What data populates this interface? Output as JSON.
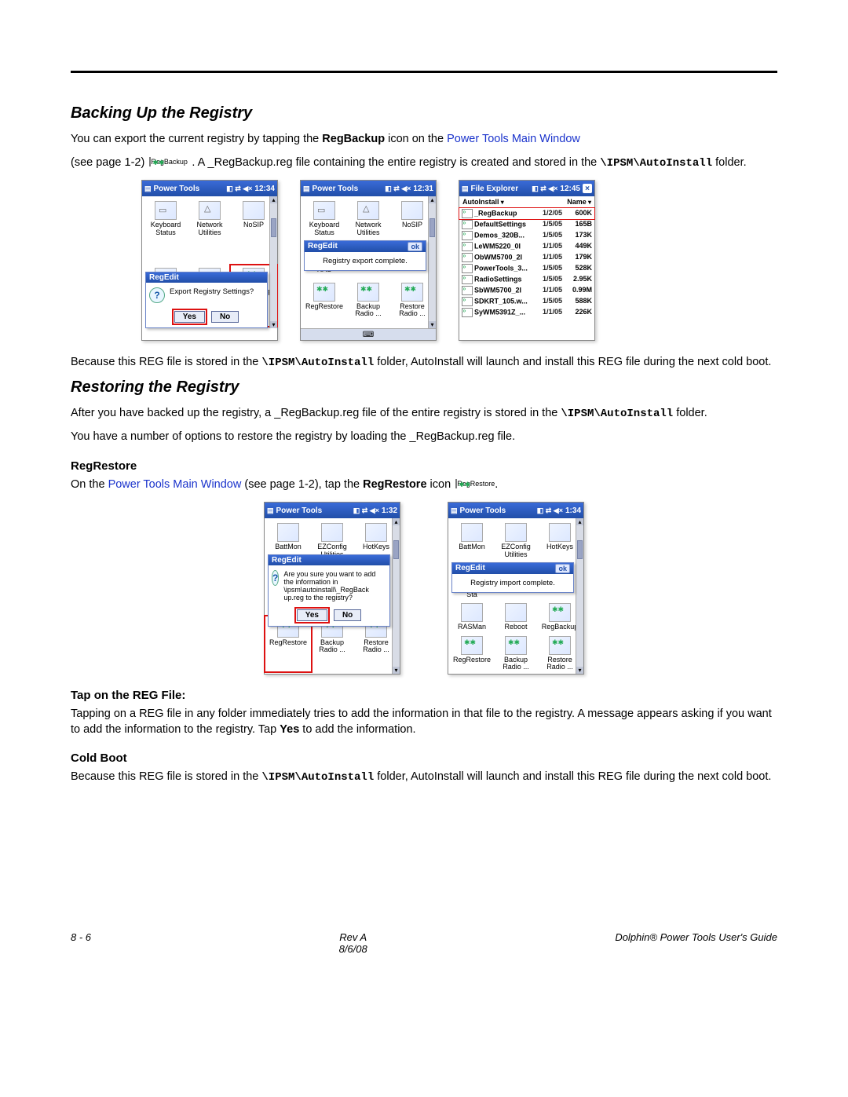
{
  "headings": {
    "backing_up": "Backing Up the Registry",
    "restoring": "Restoring the Registry",
    "regrestore": "RegRestore",
    "tap_reg": "Tap on the REG File:",
    "cold_boot": "Cold Boot"
  },
  "body": {
    "p1_a": "You can export the current registry by tapping the ",
    "p1_b": "RegBackup",
    "p1_c": " icon on the ",
    "p1_link": "Power Tools Main Window",
    "p2_a": "(see page 1-2) ",
    "p2_b": ". A _RegBackup.reg file containing the entire registry is created and stored in the ",
    "path1": "\\IPSM\\AutoInstall",
    "p2_c": " folder.",
    "p3_a": "Because this REG file is stored in the ",
    "p3_b": " folder, AutoInstall will launch and install this REG file during the next cold boot.",
    "p4": "After you have backed up the registry, a _RegBackup.reg file of the entire registry is stored in the ",
    "p4b": " folder.",
    "p5": "You have a number of options to restore the registry by loading the _RegBackup.reg file.",
    "p6_a": "On the ",
    "p6_link": "Power Tools Main Window",
    "p6_b": " (see page 1-2), tap the ",
    "p6_c": "RegRestore",
    "p6_d": " icon ",
    "p7_a": "Tapping on a REG file in any folder immediately tries to add the information in that file to the registry. A message appears asking if you want to add the information to the registry. Tap ",
    "p7_b": "Yes",
    "p7_c": " to add the information.",
    "p8_a": "Because this REG file is stored in the ",
    "p8_b": " folder, AutoInstall will launch and install this REG file during the next cold boot."
  },
  "inline_icons": {
    "regbackup": "RegBackup",
    "regrestore": "RegRestore"
  },
  "device": {
    "title_pt": "Power Tools",
    "title_fe": "File Explorer",
    "time_1234": "12:34",
    "time_1231": "12:31",
    "time_1245": "12:45",
    "time_132": "1:32",
    "time_134": "1:34",
    "icons_row1": [
      "Keyboard Status",
      "Network Utilities",
      "NoSIP"
    ],
    "icons_row2": [
      "RASMan",
      "Reboot",
      "RegBackup"
    ],
    "icons_row3": [
      "RegRestore",
      "Backup Radio ...",
      "Restore Radio ..."
    ],
    "icons_top2": [
      "BattMon",
      "EZConfig Utilities",
      "HotKeys"
    ],
    "icons_midkeyb": [
      "Keyb... Sta...",
      "",
      ""
    ],
    "popup_title": "RegEdit",
    "popup_export_q": "Export Registry Settings?",
    "popup_export_done": "Registry export complete.",
    "popup_import_q": "Are you sure you want to add the information in \\ipsm\\autoinstall\\_RegBack up.reg to the registry?",
    "popup_import_done": "Registry import complete.",
    "btn_yes": "Yes",
    "btn_no": "No",
    "btn_ok": "ok",
    "fe_dropdown": "AutoInstall",
    "fe_name": "Name",
    "files": [
      {
        "n": "_RegBackup",
        "d": "1/2/05",
        "s": "600K",
        "sel": true
      },
      {
        "n": "DefaultSettings",
        "d": "1/5/05",
        "s": "165B"
      },
      {
        "n": "Demos_320B...",
        "d": "1/5/05",
        "s": "173K"
      },
      {
        "n": "LeWM5220_0I",
        "d": "1/1/05",
        "s": "449K"
      },
      {
        "n": "ObWM5700_2I",
        "d": "1/1/05",
        "s": "179K"
      },
      {
        "n": "PowerTools_3...",
        "d": "1/5/05",
        "s": "528K"
      },
      {
        "n": "RadioSettings",
        "d": "1/5/05",
        "s": "2.95K"
      },
      {
        "n": "SbWM5700_2I",
        "d": "1/1/05",
        "s": "0.99M"
      },
      {
        "n": "SDKRT_105.w...",
        "d": "1/5/05",
        "s": "588K"
      },
      {
        "n": "SyWM5391Z_...",
        "d": "1/1/05",
        "s": "226K"
      }
    ]
  },
  "footer": {
    "left": "8 - 6",
    "center_a": "Rev A",
    "center_b": "8/6/08",
    "right": "Dolphin® Power Tools User's Guide"
  }
}
